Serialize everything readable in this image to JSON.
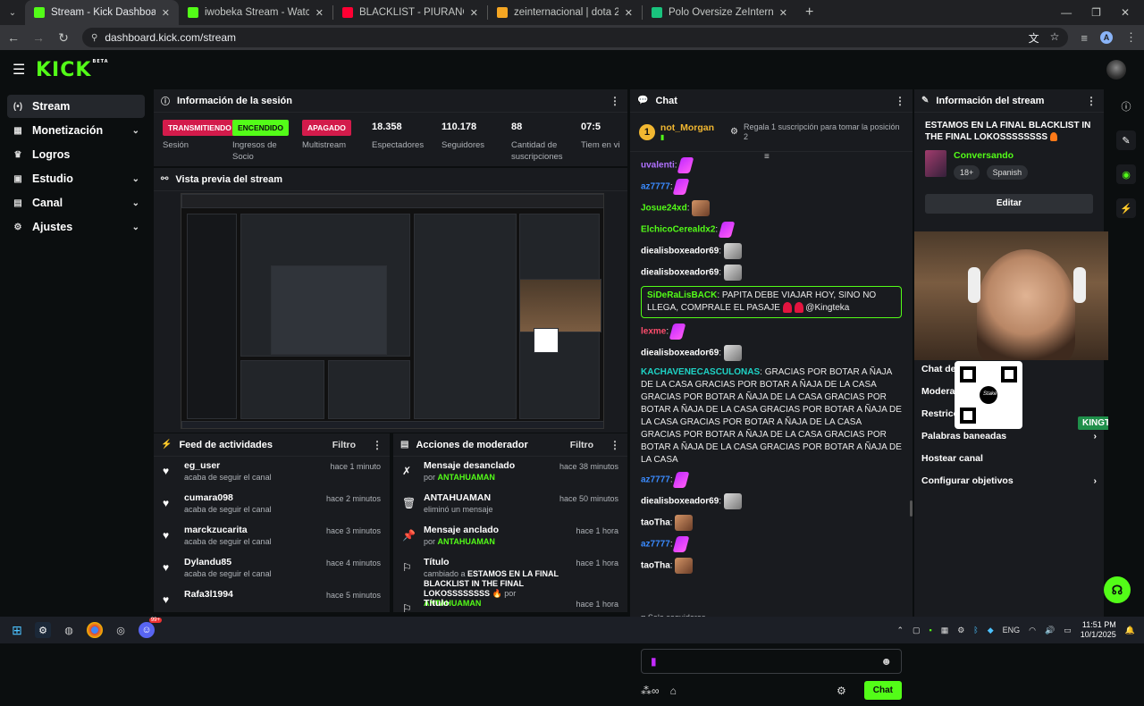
{
  "browser": {
    "tabs": [
      {
        "title": "Stream - Kick Dashboard",
        "active": true,
        "fav_color": "#53fc18"
      },
      {
        "title": "iwobeka Stream - Watch Live o",
        "active": false,
        "fav_color": "#53fc18"
      },
      {
        "title": "BLACKLIST - PIURANO 27(PRO",
        "active": false,
        "fav_color": "#ff0033"
      },
      {
        "title": "zeinternacional | dota 2 Inicio",
        "active": false,
        "fav_color": "#f5a623"
      },
      {
        "title": "Polo Oversize ZeInternacional 2",
        "active": false,
        "fav_color": "#19c37d"
      }
    ],
    "url": "dashboard.kick.com/stream",
    "profile_initial": "A"
  },
  "sidebar": {
    "items": [
      {
        "label": "Stream",
        "icon": "stream-icon",
        "glyph": "(•)",
        "has_chevron": false,
        "active": true
      },
      {
        "label": "Monetización",
        "icon": "money-icon",
        "glyph": "▦",
        "has_chevron": true,
        "active": false
      },
      {
        "label": "Logros",
        "icon": "trophy-icon",
        "glyph": "♛",
        "has_chevron": false,
        "active": false
      },
      {
        "label": "Estudio",
        "icon": "studio-icon",
        "glyph": "▣",
        "has_chevron": true,
        "active": false
      },
      {
        "label": "Canal",
        "icon": "channel-icon",
        "glyph": "▤",
        "has_chevron": true,
        "active": false
      },
      {
        "label": "Ajustes",
        "icon": "gear-icon",
        "glyph": "⚙",
        "has_chevron": true,
        "active": false
      }
    ]
  },
  "session": {
    "title": "Información de la sesión",
    "stats": [
      {
        "badge": "TRANSMITIENDO",
        "badge_color": "red",
        "label": "Sesión"
      },
      {
        "badge": "ENCENDIDO",
        "badge_color": "green",
        "label": "Ingresos de Socio"
      },
      {
        "badge": "APAGADO",
        "badge_color": "red",
        "label": "Multistream"
      },
      {
        "value": "18.358",
        "label": "Espectadores"
      },
      {
        "value": "110.178",
        "label": "Seguidores"
      },
      {
        "value": "88",
        "label": "Cantidad de suscripciones"
      },
      {
        "value": "07:5",
        "label": "Tiem en vi"
      }
    ]
  },
  "preview": {
    "title": "Vista previa del stream"
  },
  "feed": {
    "title": "Feed de actividades",
    "filter": "Filtro",
    "rows": [
      {
        "user": "eg_user",
        "action": "acaba de seguir el canal",
        "time": "hace 1 minuto"
      },
      {
        "user": "cumara098",
        "action": "acaba de seguir el canal",
        "time": "hace 2 minutos"
      },
      {
        "user": "marckzucarita",
        "action": "acaba de seguir el canal",
        "time": "hace 3 minutos"
      },
      {
        "user": "Dylandu85",
        "action": "acaba de seguir el canal",
        "time": "hace 4 minutos"
      },
      {
        "user": "Rafa3l1994",
        "action": "",
        "time": "hace 5 minutos"
      }
    ]
  },
  "mod": {
    "title": "Acciones de moderador",
    "filter": "Filtro",
    "rows": [
      {
        "icon": "unpin-icon",
        "glyph": "✗",
        "action": "Mensaje desanclado",
        "by_prefix": "por",
        "by": "ANTAHUAMAN",
        "time": "hace 38 minutos"
      },
      {
        "icon": "trash-icon",
        "glyph": "🗑",
        "action": "ANTAHUAMAN",
        "sub": "eliminó un mensaje",
        "time": "hace 50 minutos"
      },
      {
        "icon": "pin-icon",
        "glyph": "📌",
        "action": "Mensaje anclado",
        "by_prefix": "por",
        "by": "ANTAHUAMAN",
        "time": "hace 1 hora"
      },
      {
        "icon": "title-icon",
        "glyph": "⚐",
        "action": "Título",
        "sub_prefix": "cambiado a",
        "sub_bold": "ESTAMOS EN LA FINAL BLACKLIST IN THE FINAL LOKOSSSSSSSS",
        "by_prefix": "por",
        "by": "ANTAHUAMAN",
        "time": "hace 1 hora"
      },
      {
        "icon": "title-icon",
        "glyph": "⚐",
        "action": "Título",
        "time": "hace 1 hora"
      }
    ]
  },
  "chat": {
    "title": "Chat",
    "gift_rank": "1",
    "gift_user": "not_Morgan",
    "gift_cta": "Regala 1 suscripción para tomar la posición 2",
    "messages": [
      {
        "user": "uvalenti",
        "color": "#b071ff",
        "text": "",
        "emote": "pink"
      },
      {
        "user": "az7777",
        "color": "#3a8bff",
        "text": "",
        "emote": "pink"
      },
      {
        "user": "Josue24xd",
        "color": "#53fc18",
        "text": "",
        "emote": "face"
      },
      {
        "user": "ElchicoCerealdx2",
        "color": "#53fc18",
        "text": "",
        "emote": "pink"
      },
      {
        "user": "diealisboxeador69",
        "color": "#ffffff",
        "text": "",
        "emote": "cat"
      },
      {
        "user": "diealisboxeador69",
        "color": "#ffffff",
        "text": "",
        "emote": "cat"
      },
      {
        "user": "SiDeRaLisBACK",
        "color": "#53fc18",
        "text": "PAPITA DEBE VIAJAR HOY, SINO NO LLEGA, COMPRALE EL PASAJE",
        "mention": "@Kingteka",
        "highlight": true
      },
      {
        "user": "lexme",
        "color": "#ff4d6d",
        "text": "",
        "emote": "pink"
      },
      {
        "user": "diealisboxeador69",
        "color": "#ffffff",
        "text": "",
        "emote": "cat"
      },
      {
        "user": "KACHAVENECASCULONAS",
        "color": "#1fd3c6",
        "text": "GRACIAS POR BOTAR A ÑAJA DE LA CASA GRACIAS POR BOTAR A ÑAJA DE LA CASA GRACIAS POR BOTAR A ÑAJA DE LA CASA GRACIAS POR BOTAR A ÑAJA DE LA CASA GRACIAS POR BOTAR A ÑAJA DE LA CASA GRACIAS POR BOTAR A ÑAJA DE LA CASA GRACIAS POR BOTAR A ÑAJA DE LA CASA GRACIAS POR BOTAR A ÑAJA DE LA CASA GRACIAS POR BOTAR A ÑAJA DE LA CASA"
      },
      {
        "user": "az7777",
        "color": "#3a8bff",
        "text": "",
        "emote": "pink"
      },
      {
        "user": "diealisboxeador69",
        "color": "#ffffff",
        "text": "",
        "emote": "cat"
      },
      {
        "user": "taoTha",
        "color": "#ffffff",
        "text": "",
        "emote": "face"
      },
      {
        "user": "az7777",
        "color": "#3a8bff",
        "text": "",
        "emote": "pink"
      },
      {
        "user": "taoTha",
        "color": "#ffffff",
        "text": "",
        "emote": "face"
      }
    ],
    "followers_only": "Solo seguidores",
    "send_label": "Chat"
  },
  "stream_info": {
    "title": "Información del stream",
    "stream_title": "ESTAMOS EN LA FINAL BLACKLIST IN THE FINAL LOKOSSSSSSSS",
    "category": "Conversando",
    "tags": [
      "18+",
      "Spanish"
    ],
    "edit_label": "Editar",
    "rows": [
      {
        "label": "Chat de",
        "chevron": false
      },
      {
        "label": "Moderac",
        "chevron": false,
        "suffix": "IA"
      },
      {
        "label": "Restricc",
        "chevron": false
      },
      {
        "label": "Palabras baneadas",
        "chevron": true
      },
      {
        "label": "Hostear canal",
        "chevron": false
      },
      {
        "label": "Configurar objetivos",
        "chevron": true
      }
    ]
  },
  "overlay": {
    "qr_brand": "Stake",
    "name_tag": "KINGTEKA"
  },
  "taskbar": {
    "lang": "ENG",
    "time": "11:51 PM",
    "date": "10/1/2025",
    "discord_badge": "99+"
  },
  "colors": {
    "accent": "#53fc18",
    "live_red": "#d31b4b",
    "panel": "#191b1f",
    "bg": "#0b0e0f"
  }
}
